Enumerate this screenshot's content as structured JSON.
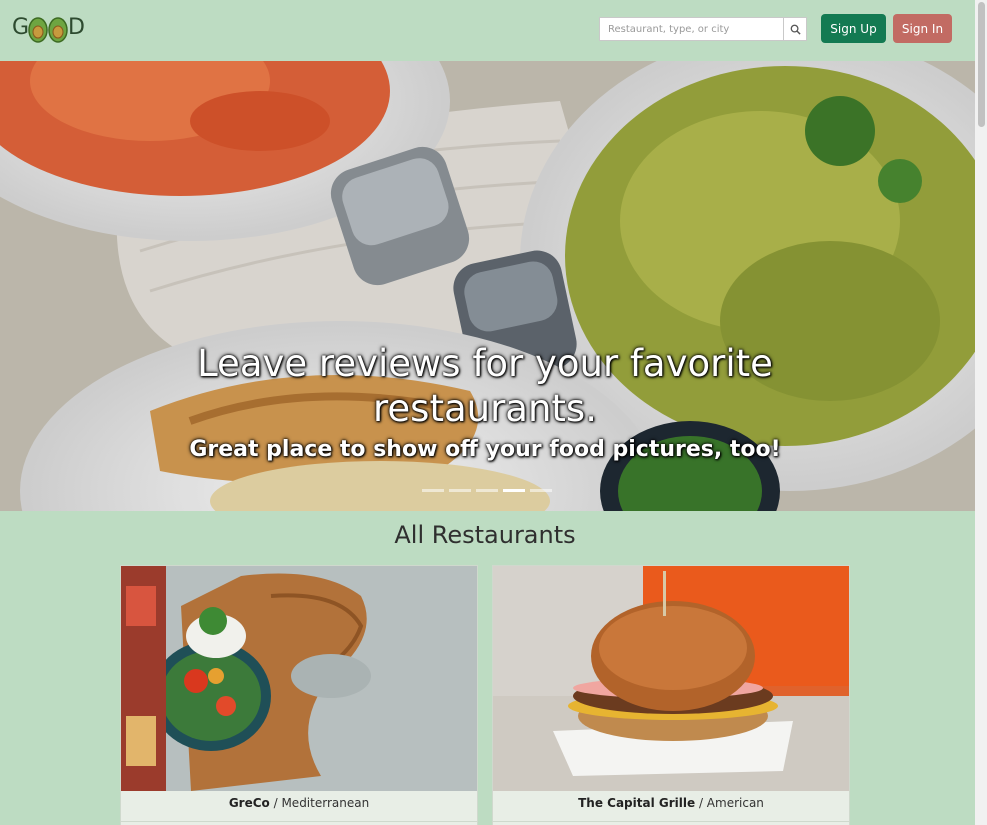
{
  "header": {
    "logo_g": "G",
    "logo_d": "D",
    "search_placeholder": "Restaurant, type, or city",
    "search_icon": "search-icon",
    "signup_label": "Sign Up",
    "signin_label": "Sign In"
  },
  "hero": {
    "title": "Leave reviews for your favorite restaurants.",
    "subtitle": "Great place to show off your food pictures, too!",
    "indicators": [
      {
        "active": false
      },
      {
        "active": false
      },
      {
        "active": false
      },
      {
        "active": true
      },
      {
        "active": false
      }
    ]
  },
  "section": {
    "title": "All Restaurants"
  },
  "restaurants": [
    {
      "name": "GreCo",
      "cuisine": "Mediterranean"
    },
    {
      "name": "The Capital Grille",
      "cuisine": "American"
    }
  ],
  "colors": {
    "background": "#bddcc2",
    "signup": "#137a52",
    "signin": "#c26b63"
  }
}
